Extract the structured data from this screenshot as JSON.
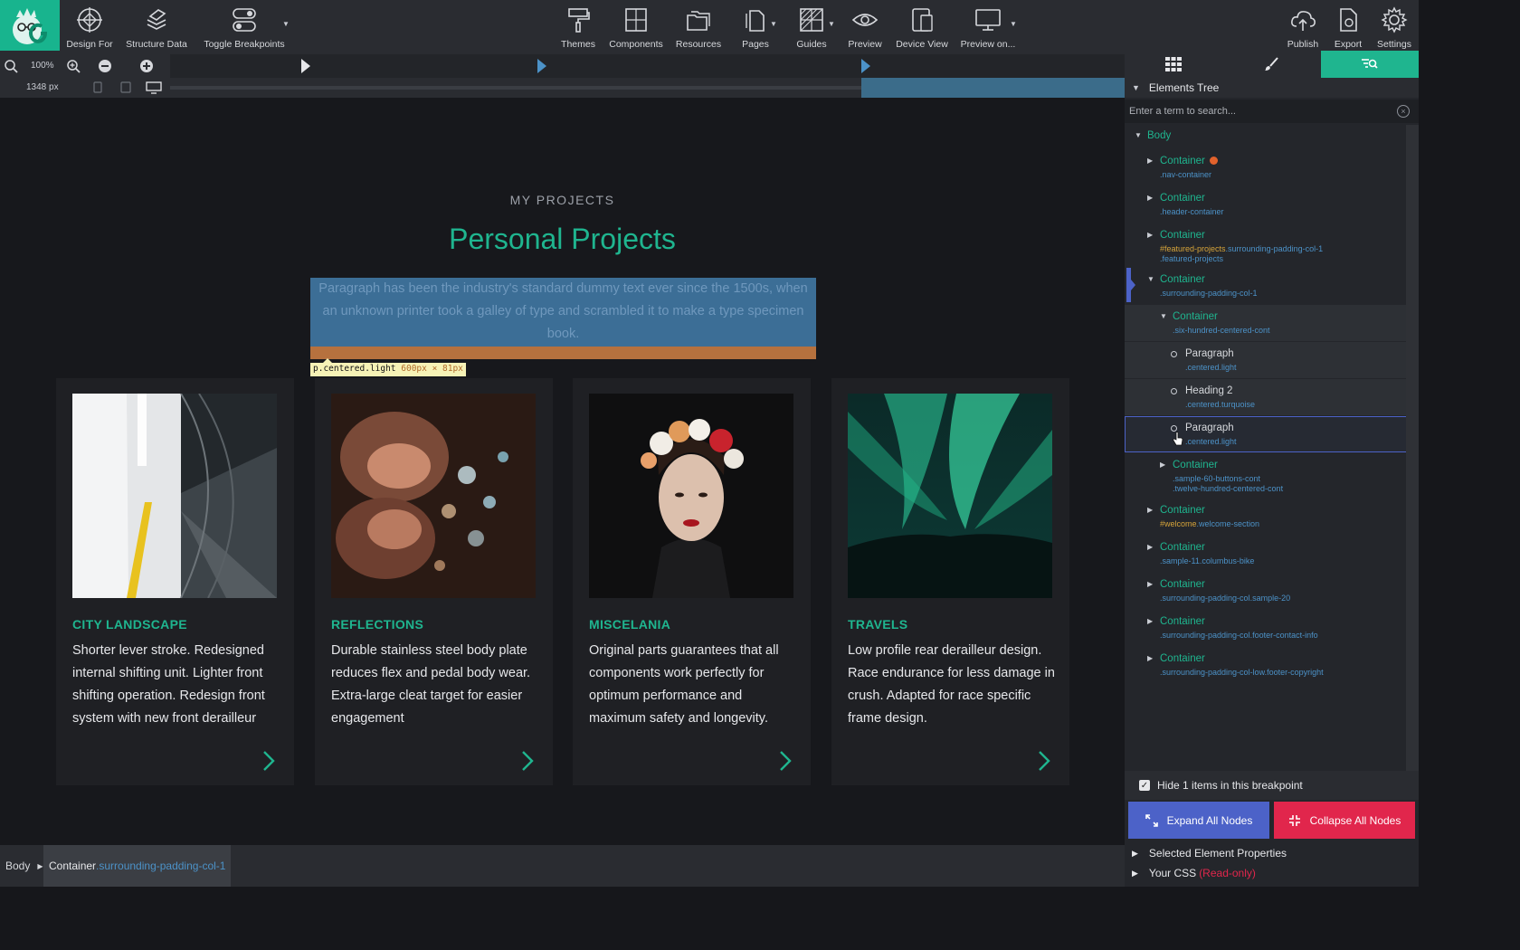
{
  "toolbar": {
    "design_for": "Design For",
    "structure_data": "Structure Data",
    "toggle_breakpoints": "Toggle Breakpoints",
    "themes": "Themes",
    "components": "Components",
    "resources": "Resources",
    "pages": "Pages",
    "guides": "Guides",
    "preview": "Preview",
    "device_view": "Device View",
    "preview_on": "Preview on...",
    "publish": "Publish",
    "export": "Export",
    "settings": "Settings"
  },
  "zoom": {
    "value": "100%",
    "width": "1348 px"
  },
  "canvas": {
    "eyebrow": "MY PROJECTS",
    "title": "Personal Projects",
    "paragraph": "Paragraph has been the industry's standard dummy text ever since the 1500s, when an unknown printer took a galley of type and scrambled it to make a type specimen book.",
    "selection_selector": "p.centered.light",
    "selection_dims": "600px × 81px",
    "cards": [
      {
        "title": "CITY LANDSCAPE",
        "text": "Shorter lever stroke. Redesigned internal shifting unit. Lighter front shifting operation. Redesign front system with new front derailleur"
      },
      {
        "title": "REFLECTIONS",
        "text": "Durable stainless steel body plate reduces flex and pedal body wear. Extra-large cleat target for easier engagement"
      },
      {
        "title": "MISCELANIA",
        "text": "Original parts guarantees that all components work perfectly for optimum performance and maximum safety and longevity."
      },
      {
        "title": "TRAVELS",
        "text": "Low profile rear derailleur design. Race endurance for less damage in crush. Adapted for race specific frame design."
      }
    ]
  },
  "statusbar": {
    "body": "Body",
    "container": "Container",
    "container_class": ".surrounding-padding-col-1"
  },
  "panel": {
    "tree_title": "Elements Tree",
    "search_placeholder": "Enter a term to search...",
    "root": "Body",
    "nodes": [
      {
        "name": "Container",
        "sub": ".nav-container"
      },
      {
        "name": "Container",
        "sub": ".header-container"
      },
      {
        "name": "Container",
        "sub_id": "#featured-projects",
        "sub": ".surrounding-padding-col-1",
        "sub2": ".featured-projects"
      },
      {
        "name": "Container",
        "sub": ".surrounding-padding-col-1"
      },
      {
        "name": "Container",
        "sub": ".six-hundred-centered-cont"
      },
      {
        "name": "Paragraph",
        "sub": ".centered.light"
      },
      {
        "name": "Heading 2",
        "sub": ".centered.turquoise"
      },
      {
        "name": "Paragraph",
        "sub": ".centered.light"
      },
      {
        "name": "Container",
        "sub": ".sample-60-buttons-cont",
        "sub2": ".twelve-hundred-centered-cont"
      },
      {
        "name": "Container",
        "sub_id": "#welcome",
        "sub": ".welcome-section"
      },
      {
        "name": "Container",
        "sub": ".sample-11.columbus-bike"
      },
      {
        "name": "Container",
        "sub": ".surrounding-padding-col.sample-20"
      },
      {
        "name": "Container",
        "sub": ".surrounding-padding-col.footer-contact-info"
      },
      {
        "name": "Container",
        "sub": ".surrounding-padding-col-low.footer-copyright"
      }
    ],
    "hide_items": "Hide 1 items in this breakpoint",
    "expand_all": "Expand All Nodes",
    "collapse_all": "Collapse All Nodes",
    "selected_props": "Selected Element Properties",
    "your_css": "Your CSS",
    "read_only": "(Read-only)"
  },
  "colors": {
    "accent": "#1fb58f",
    "selection": "#3c6e96",
    "primary_button": "#4c62c8",
    "danger_button": "#e1264c"
  }
}
